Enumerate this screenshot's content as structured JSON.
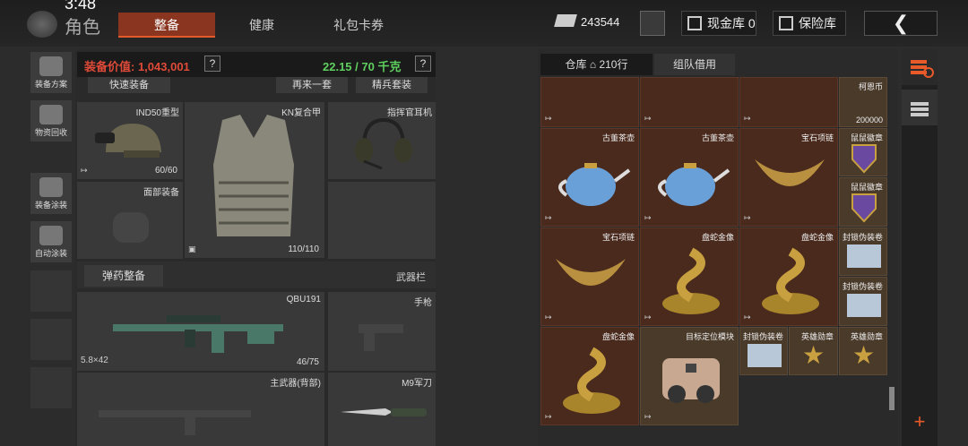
{
  "header": {
    "clock": "3:48",
    "page_title": "角色",
    "tabs": [
      "整备",
      "健康",
      "礼包卡券"
    ],
    "active_tab": "整备",
    "cash": "243544",
    "cash_depot": "现金库 0",
    "safe_depot": "保险库",
    "back_icon": "chevron-left-icon"
  },
  "sidebar": {
    "items": [
      {
        "label": "装备方案",
        "icon": "loadout-icon"
      },
      {
        "label": "物资回收",
        "icon": "recycle-icon"
      },
      {
        "label": "装备涂装",
        "icon": "helmet-icon"
      },
      {
        "label": "自动涂装",
        "icon": "spray-icon"
      }
    ]
  },
  "equipment": {
    "value_label": "装备价值: 1,043,001",
    "weight_label": "22.15 / 70 千克",
    "help": "?",
    "buttons": [
      "快速装备",
      "再来一套",
      "精兵套装"
    ],
    "slots": {
      "helmet": {
        "name": "IND50重型",
        "dura": "60/60"
      },
      "armor": {
        "name": "KN复合甲",
        "dura": "110/110"
      },
      "headset": {
        "name": "指挥官耳机"
      },
      "face": {
        "name": "面部装备"
      },
      "ammo_btn": "弹药整备",
      "weapon_section": "武器栏",
      "primary": {
        "name": "QBU191",
        "caliber": "5.8×42",
        "ammo": "46/75"
      },
      "pistol": {
        "name": "手枪"
      },
      "backup": {
        "name": "主武器(背部)"
      },
      "knife": {
        "name": "M9军刀"
      }
    }
  },
  "warehouse": {
    "tab_storage": "仓库",
    "rows": "210行",
    "tab_team": "组队借用",
    "items": [
      {
        "name": "古董茶壶"
      },
      {
        "name": "古董茶壶"
      },
      {
        "name": "宝石项链"
      },
      {
        "name": "宝石项链"
      },
      {
        "name": "盘蛇金像"
      },
      {
        "name": "盘蛇金像"
      },
      {
        "name": "盘蛇金像"
      },
      {
        "name": "目标定位模块"
      }
    ],
    "small": [
      {
        "name": "柯恩币",
        "count": "200000"
      },
      {
        "name": "鼠鼠徽章"
      },
      {
        "name": "鼠鼠徽章"
      },
      {
        "name": "封锁伪装卷"
      },
      {
        "name": "封锁伪装卷"
      },
      {
        "name": "封锁伪装卷"
      },
      {
        "name": "英雄勋章"
      },
      {
        "name": "英雄勋章"
      }
    ],
    "out_glyph": "↦"
  },
  "colors": {
    "accent": "#e25a2a",
    "value_red": "#e04a38",
    "weight_green": "#5fcf5f",
    "cell": "#4a2a1d"
  },
  "add_label": "+"
}
